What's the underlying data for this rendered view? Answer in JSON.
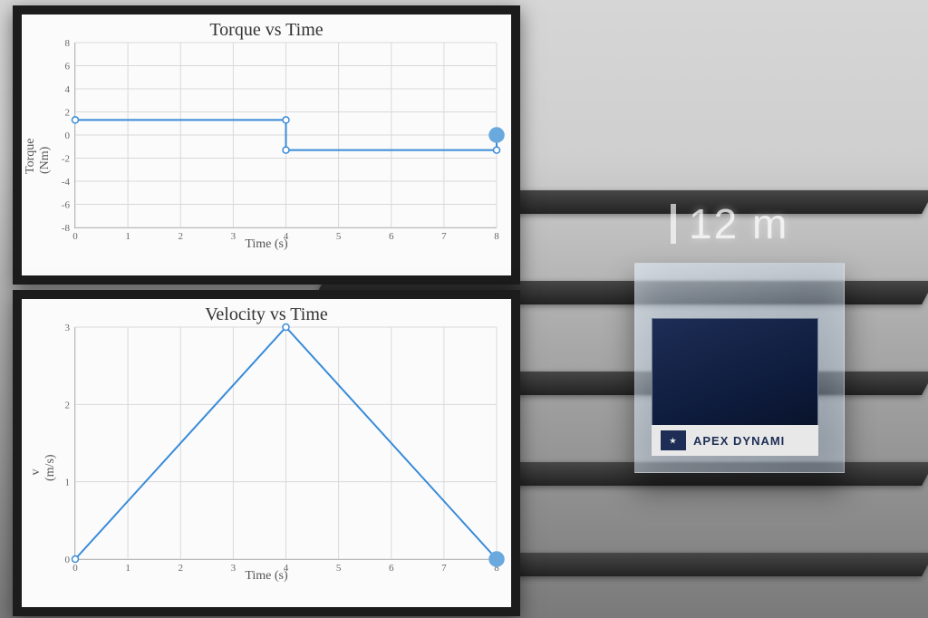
{
  "scene": {
    "scale_marker": "12 m",
    "brand_label": "APEX DYNAMI"
  },
  "chart_data": [
    {
      "type": "line",
      "title": "Torque vs Time",
      "xlabel": "Time (s)",
      "ylabel": "Torque (Nm)",
      "xlim": [
        0,
        8
      ],
      "ylim": [
        -8,
        8
      ],
      "x_ticks": [
        0,
        1,
        2,
        3,
        4,
        5,
        6,
        7,
        8
      ],
      "y_ticks": [
        -8,
        -6,
        -4,
        -2,
        0,
        2,
        4,
        6,
        8
      ],
      "x": [
        0,
        4,
        4,
        8,
        8
      ],
      "y": [
        1.3,
        1.3,
        -1.3,
        -1.3,
        0
      ],
      "highlight_point": {
        "x": 8,
        "y": 0
      }
    },
    {
      "type": "line",
      "title": "Velocity vs Time",
      "xlabel": "Time (s)",
      "ylabel": "v (m/s)",
      "xlim": [
        0,
        8
      ],
      "ylim": [
        0,
        3
      ],
      "x_ticks": [
        0,
        1,
        2,
        3,
        4,
        5,
        6,
        7,
        8
      ],
      "y_ticks": [
        0,
        1,
        2,
        3
      ],
      "x": [
        0,
        4,
        8
      ],
      "y": [
        0,
        3,
        0
      ],
      "highlight_point": {
        "x": 8,
        "y": 0
      }
    }
  ]
}
